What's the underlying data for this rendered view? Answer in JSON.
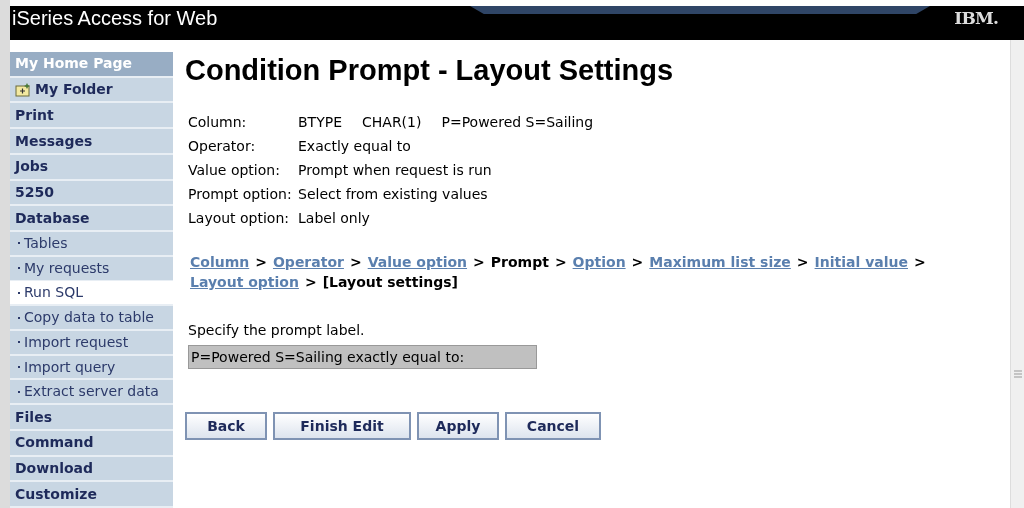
{
  "header": {
    "title": "iSeries Access for Web",
    "logo": "IBM."
  },
  "sidebar": {
    "items": [
      {
        "label": "My Home Page",
        "kind": "home",
        "selected": false
      },
      {
        "label": "My Folder",
        "kind": "folder",
        "selected": false
      },
      {
        "label": "Print",
        "kind": "section",
        "selected": false
      },
      {
        "label": "Messages",
        "kind": "section",
        "selected": false
      },
      {
        "label": "Jobs",
        "kind": "section",
        "selected": false
      },
      {
        "label": "5250",
        "kind": "section",
        "selected": false
      },
      {
        "label": "Database",
        "kind": "section",
        "selected": false
      },
      {
        "label": "Tables",
        "kind": "sub",
        "selected": false
      },
      {
        "label": "My requests",
        "kind": "sub",
        "selected": false
      },
      {
        "label": "Run SQL",
        "kind": "sub",
        "selected": true
      },
      {
        "label": "Copy data to table",
        "kind": "sub",
        "selected": false
      },
      {
        "label": "Import request",
        "kind": "sub",
        "selected": false
      },
      {
        "label": "Import query",
        "kind": "sub",
        "selected": false
      },
      {
        "label": "Extract server data",
        "kind": "sub",
        "selected": false
      },
      {
        "label": "Files",
        "kind": "section",
        "selected": false
      },
      {
        "label": "Command",
        "kind": "section",
        "selected": false
      },
      {
        "label": "Download",
        "kind": "section",
        "selected": false
      },
      {
        "label": "Customize",
        "kind": "section",
        "selected": false
      }
    ]
  },
  "page": {
    "title": "Condition Prompt - Layout Settings",
    "summary": [
      {
        "label": "Column:",
        "values": [
          "BTYPE",
          "CHAR(1)",
          "P=Powered S=Sailing"
        ]
      },
      {
        "label": "Operator:",
        "values": [
          "Exactly equal to"
        ]
      },
      {
        "label": "Value option:",
        "values": [
          "Prompt when request is run"
        ]
      },
      {
        "label": "Prompt option:",
        "values": [
          "Select from existing values"
        ]
      },
      {
        "label": "Layout option:",
        "values": [
          "Label only"
        ]
      }
    ],
    "breadcrumb": [
      {
        "label": "Column",
        "kind": "link"
      },
      {
        "label": "Operator",
        "kind": "link"
      },
      {
        "label": "Value option",
        "kind": "link"
      },
      {
        "label": "Prompt",
        "kind": "current"
      },
      {
        "label": "Option",
        "kind": "link"
      },
      {
        "label": "Maximum list size",
        "kind": "link"
      },
      {
        "label": "Initial value",
        "kind": "link"
      },
      {
        "label": "Layout option",
        "kind": "link"
      },
      {
        "label": "[Layout settings]",
        "kind": "current"
      }
    ],
    "separator": ">",
    "instruction": "Specify the prompt label.",
    "prompt_label": {
      "value": "P=Powered S=Sailing exactly equal to:"
    },
    "buttons": [
      "Back",
      "Finish Edit",
      "Apply",
      "Cancel"
    ]
  }
}
